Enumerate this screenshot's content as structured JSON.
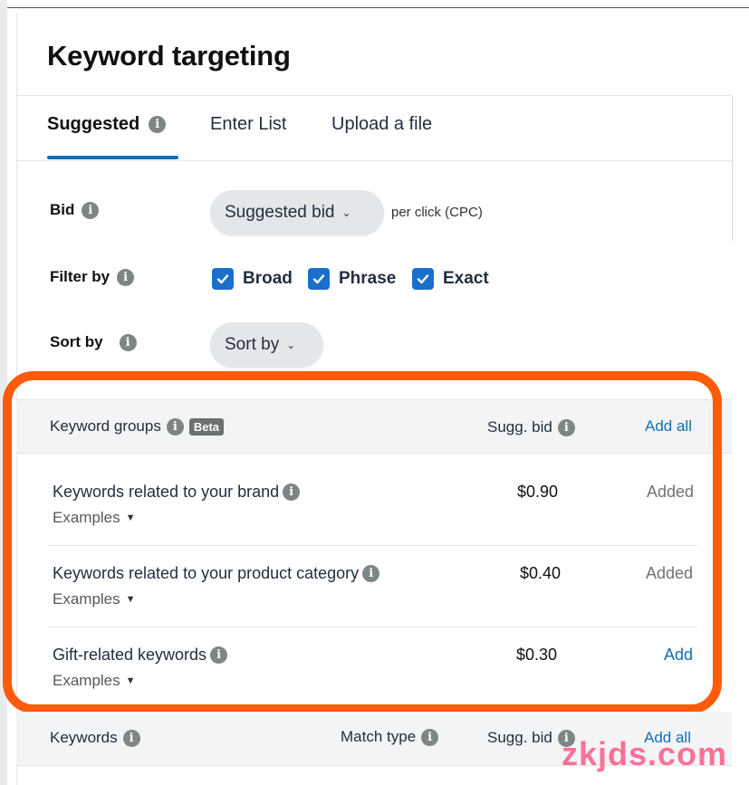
{
  "page": {
    "title": "Keyword targeting"
  },
  "tabs": [
    {
      "label": "Suggested",
      "active": true
    },
    {
      "label": "Enter List",
      "active": false
    },
    {
      "label": "Upload a file",
      "active": false
    }
  ],
  "form": {
    "bid_label": "Bid",
    "bid_select_value": "Suggested bid",
    "per_click": "per click (CPC)",
    "filter_label": "Filter by",
    "filters": [
      {
        "label": "Broad",
        "checked": true
      },
      {
        "label": "Phrase",
        "checked": true
      },
      {
        "label": "Exact",
        "checked": true
      }
    ],
    "sort_label": "Sort by",
    "sort_select_value": "Sort by"
  },
  "groups_table": {
    "header": {
      "title": "Keyword groups",
      "badge": "Beta",
      "bid_col": "Sugg. bid",
      "add_all": "Add all"
    },
    "rows": [
      {
        "title": "Keywords related to your brand",
        "examples": "Examples",
        "bid": "$0.90",
        "action": "Added"
      },
      {
        "title": "Keywords related to your product category",
        "examples": "Examples",
        "bid": "$0.40",
        "action": "Added"
      },
      {
        "title": "Gift-related keywords",
        "examples": "Examples",
        "bid": "$0.30",
        "action": "Add"
      }
    ]
  },
  "keywords_table": {
    "header": {
      "title": "Keywords",
      "match_col": "Match type",
      "bid_col": "Sugg. bid",
      "add_all": "Add all"
    }
  },
  "watermark": "zkjds.com",
  "colors": {
    "accent": "#146eb4",
    "checkbox": "#1a6fc9",
    "highlight_box": "#ff5b0a",
    "watermark": "#ff3a6e"
  }
}
